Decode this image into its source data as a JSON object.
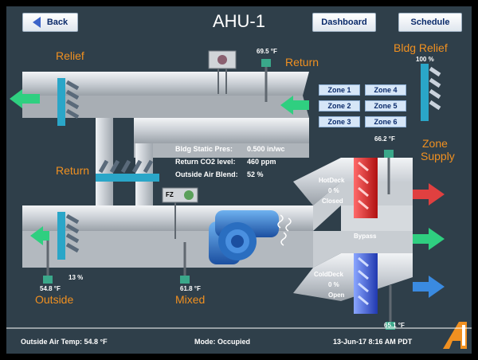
{
  "header": {
    "back_label": "Back",
    "title": "AHU-1",
    "dashboard_label": "Dashboard",
    "schedule_label": "Schedule"
  },
  "labels": {
    "relief": "Relief",
    "return_top": "Return",
    "return_mid": "Return",
    "bldg_relief": "Bldg Relief",
    "zone_supply_1": "Zone",
    "zone_supply_2": "Supply",
    "outside": "Outside",
    "mixed": "Mixed",
    "bypass": "Bypass",
    "fz": "FZ"
  },
  "readings": {
    "return_temp": "69.5 °F",
    "bldg_relief_pct": "100 %",
    "supply_temp": "66.2 °F",
    "outside_temp": "54.8 °F",
    "outside_damper_pct": "13 %",
    "mixed_temp": "61.8 °F",
    "coldeck_temp": "65.1 °F"
  },
  "hotdeck": {
    "name": "HotDeck",
    "pct": "0 %",
    "state": "Closed"
  },
  "colddeck": {
    "name": "ColdDeck",
    "pct": "0 %",
    "state": "Open"
  },
  "zones": [
    "Zone 1",
    "Zone 4",
    "Zone 2",
    "Zone 5",
    "Zone 3",
    "Zone 6"
  ],
  "info": {
    "static_label": "Bldg Static Pres:",
    "static_value": "0.500 in/wc",
    "co2_label": "Return CO2 level:",
    "co2_value": "460 ppm",
    "blend_label": "Outside Air Blend:",
    "blend_value": "52 %"
  },
  "statusbar": {
    "oat": "Outside Air Temp:  54.8 °F",
    "mode": "Mode: Occupied",
    "datetime": "13-Jun-17  8:16 AM PDT"
  },
  "colors": {
    "panel": "#2f3f4a",
    "label_orange": "#f09020",
    "green_arrow": "#2fcf80",
    "hot": "#e03030",
    "cold": "#3a62d6"
  }
}
